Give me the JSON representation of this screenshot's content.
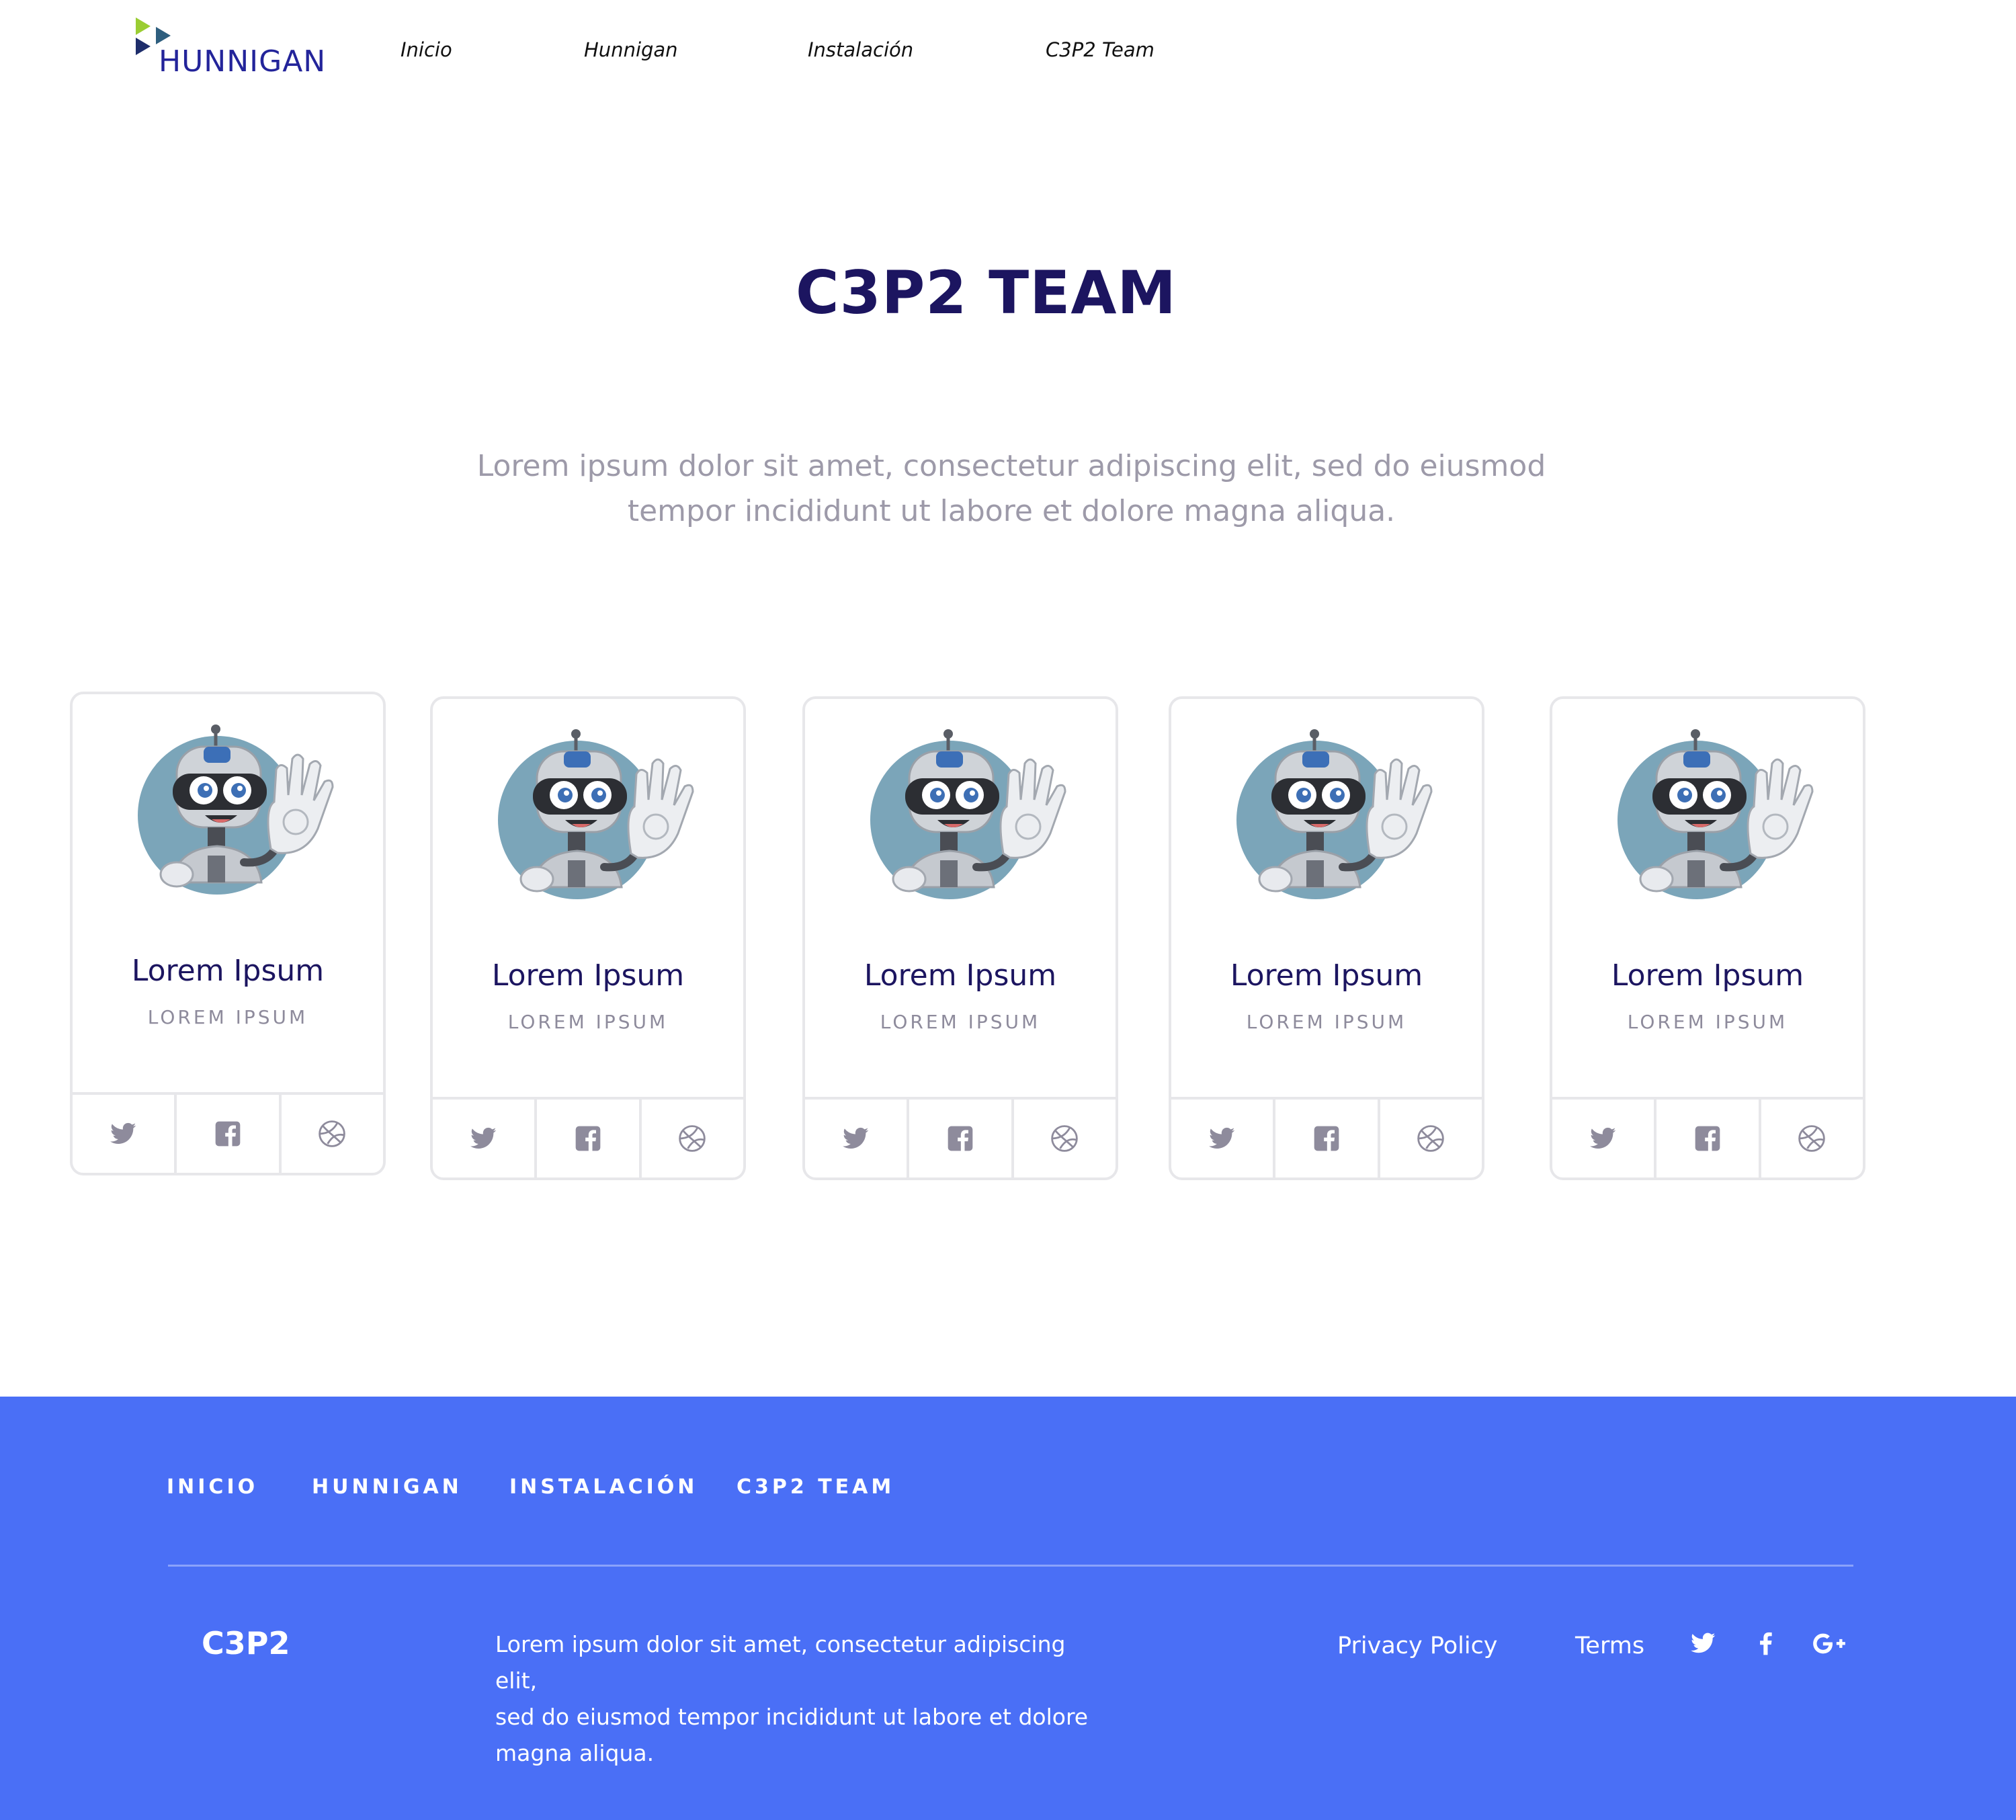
{
  "brand": {
    "logo_text": "HUNNIGAN",
    "accent_green": "#9acd32",
    "accent_navy": "#1e2d6b"
  },
  "nav": {
    "items": [
      {
        "label": "Inicio"
      },
      {
        "label": "Hunnigan"
      },
      {
        "label": "Instalación"
      },
      {
        "label": "C3P2 Team"
      }
    ]
  },
  "hero": {
    "title": "C3P2 TEAM",
    "subtitle_line1": "Lorem ipsum dolor sit amet, consectetur adipiscing elit, sed do eiusmod",
    "subtitle_line2": "tempor incididunt ut labore et dolore magna aliqua."
  },
  "team": {
    "members": [
      {
        "name": "Lorem Ipsum",
        "role": "LOREM IPSUM"
      },
      {
        "name": "Lorem Ipsum",
        "role": "LOREM IPSUM"
      },
      {
        "name": "Lorem Ipsum",
        "role": "LOREM IPSUM"
      },
      {
        "name": "Lorem Ipsum",
        "role": "LOREM IPSUM"
      },
      {
        "name": "Lorem Ipsum",
        "role": "LOREM IPSUM"
      }
    ],
    "social_icons": [
      "twitter-icon",
      "facebook-icon",
      "dribbble-icon"
    ]
  },
  "footer": {
    "links": [
      {
        "label": "INICIO"
      },
      {
        "label": "HUNNIGAN"
      },
      {
        "label": "INSTALACIÓN"
      },
      {
        "label": "C3P2 TEAM"
      }
    ],
    "brand": "C3P2",
    "text_line1": "Lorem ipsum dolor sit amet, consectetur adipiscing elit,",
    "text_line2": "sed do eiusmod tempor incididunt ut labore et dolore",
    "text_line3": "magna aliqua.",
    "privacy": "Privacy Policy",
    "terms": "Terms",
    "social_icons": [
      "twitter-icon",
      "facebook-icon",
      "google-plus-icon"
    ],
    "background": "#4a6ff6"
  }
}
